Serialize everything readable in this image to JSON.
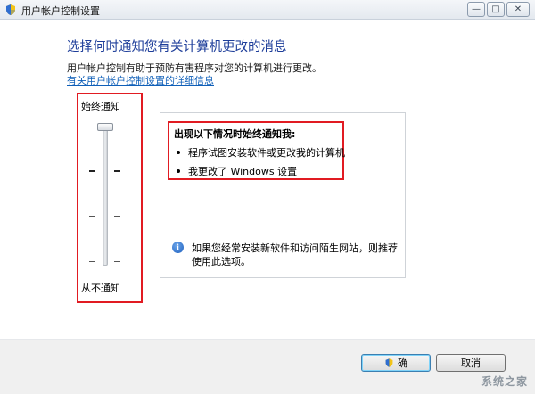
{
  "window": {
    "title": "用户帐户控制设置",
    "buttons": {
      "minimize": "—",
      "maximize": "□",
      "close": "✕"
    }
  },
  "header": {
    "heading": "选择何时通知您有关计算机更改的消息",
    "description": "用户帐户控制有助于预防有害程序对您的计算机进行更改。",
    "link": "有关用户帐户控制设置的详细信息"
  },
  "slider": {
    "top_label": "始终通知",
    "bottom_label": "从不通知",
    "levels": 4,
    "selected_level": 4
  },
  "panel": {
    "title": "出现以下情况时始终通知我:",
    "items": [
      "程序试图安装软件或更改我的计算机",
      "我更改了 Windows 设置"
    ],
    "tip": "如果您经常安装新软件和访问陌生网站，则推荐使用此选项。"
  },
  "footer": {
    "ok_label": "确",
    "cancel_label": "取消"
  },
  "watermark": "系统之家",
  "colors": {
    "heading": "#1e3e9a",
    "link": "#0f5fb8",
    "highlight": "#e11b22"
  }
}
